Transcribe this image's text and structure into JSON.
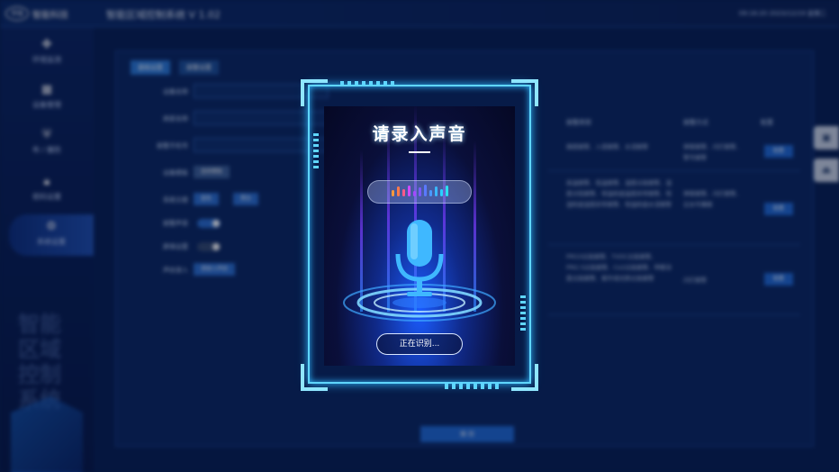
{
  "header": {
    "brand_logo": "华恒",
    "brand_name": "智能科技",
    "app_title": "智能区域控制系统 V 1.02",
    "clock": "09:16:20 2023/12/19 星期二"
  },
  "sidebar": {
    "items": [
      {
        "label": "环境监测",
        "icon": "sensor-icon"
      },
      {
        "label": "设备管理",
        "icon": "device-icon"
      },
      {
        "label": "布 / 撤防",
        "icon": "shield-icon"
      },
      {
        "label": "密码设置",
        "icon": "lock-icon"
      },
      {
        "label": "系统设置",
        "icon": "gear-icon",
        "active": true
      }
    ],
    "watermark": "智能区域控制系统"
  },
  "settings": {
    "tabs": [
      "基础设置",
      "报警设置"
    ],
    "form": {
      "device_name": "设备名称",
      "merchant_name": "商家名称",
      "alarm_phone": "报警手机号",
      "device_template": "设备模板",
      "device_template_btn": "选择模板",
      "theme": "系统主题",
      "theme_opt1": "蓝色",
      "theme_opt2": "黑白",
      "alarm_sound": "报警声音",
      "alarm_sound_state": "开启",
      "screensaver": "屏保设置",
      "screensaver_state": "关闭",
      "voice_input": "声纹录入",
      "voice_input_btn": "请录入声纹"
    },
    "table": {
      "headers": [
        "报警类型",
        "报警方式",
        "配置"
      ],
      "rows": [
        {
          "type": "烟感报警、入侵报警、水浸报警",
          "method": "弹窗报警、闪灯报警、警号报警",
          "config": "配置"
        },
        {
          "type": "高温报警、低温报警、湿度过高报警、湿度过低报警、恒温机组温度异常报警、恒湿机组湿度异常报警、恒温机组水浸报警",
          "method": "弹窗报警、闪灯报警、云台号播报",
          "config": "配置"
        },
        {
          "type": "PM10过高报警、TVOC过高报警、PM2.5过高报警、Co2过高报警、甲醛浓度过高报警、紫外线光照过高报警",
          "method": "闪灯报警",
          "config": "配置"
        }
      ]
    },
    "submit": "保 存"
  },
  "voice_modal": {
    "title": "请录入声音",
    "status": "正在识别..."
  },
  "colors": {
    "accent": "#5fd6ff",
    "card_glow": "#1b5cff",
    "mic": "#3fb8ff"
  }
}
